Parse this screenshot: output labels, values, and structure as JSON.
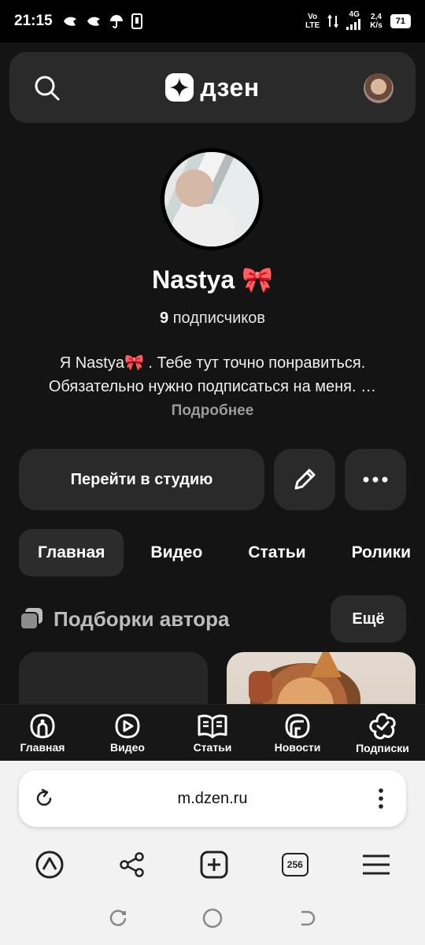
{
  "status_bar": {
    "time": "21:15",
    "network_speed_top": "2,4",
    "network_speed_bottom": "K/s",
    "signal_text_top": "Vo",
    "signal_text_bottom": "LTE",
    "gen": "4G",
    "battery": "71"
  },
  "header": {
    "logo_text": "дзен",
    "search_icon": "search-icon"
  },
  "profile": {
    "name": "Nastya 🎀",
    "subscribers_count": "9",
    "subscribers_label": "подписчиков",
    "bio": "Я Nastya🎀 . Тебе тут точно понравиться. Обязательно нужно подписаться на меня. …",
    "more_label": "Подробнее"
  },
  "actions": {
    "studio_label": "Перейти в студию"
  },
  "tabs": [
    {
      "label": "Главная",
      "active": true
    },
    {
      "label": "Видео",
      "active": false
    },
    {
      "label": "Статьи",
      "active": false
    },
    {
      "label": "Ролики",
      "active": false
    }
  ],
  "collections": {
    "title": "Подборки автора",
    "more_label": "Ещё"
  },
  "bottom_nav": [
    {
      "label": "Главная",
      "icon": "home-icon"
    },
    {
      "label": "Видео",
      "icon": "video-icon"
    },
    {
      "label": "Статьи",
      "icon": "articles-icon"
    },
    {
      "label": "Новости",
      "icon": "news-icon"
    },
    {
      "label": "Подписки",
      "icon": "subscriptions-icon"
    }
  ],
  "browser": {
    "url": "m.dzen.ru",
    "tab_count": "256"
  }
}
